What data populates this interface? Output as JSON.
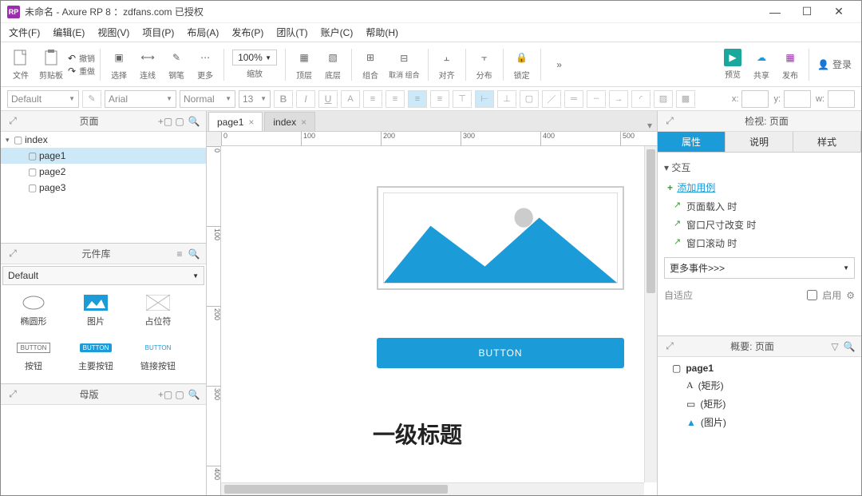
{
  "title": "未命名 - Axure RP 8 ：zdfans.com 已授权",
  "menus": [
    "文件(F)",
    "编辑(E)",
    "视图(V)",
    "项目(P)",
    "布局(A)",
    "发布(P)",
    "团队(T)",
    "账户(C)",
    "帮助(H)"
  ],
  "toolbar": {
    "file": "文件",
    "clipboard": "剪贴板",
    "undo": "撤销",
    "redo": "重做",
    "select": "选择",
    "connect": "连线",
    "pen": "钢笔",
    "more": "更多",
    "zoom": "100%",
    "zoom_lbl": "缩放",
    "front": "顶层",
    "back": "底层",
    "group": "组合",
    "ungroup": "取消 组合",
    "align": "对齐",
    "dist": "分布",
    "lockaxis": "锁定",
    "preview": "预览",
    "share": "共享",
    "publish": "发布",
    "login": "登录"
  },
  "fmt": {
    "style": "Default",
    "font": "Arial",
    "weight": "Normal",
    "size": "13",
    "x": "x:",
    "y": "y:",
    "w": "w:"
  },
  "panels": {
    "pages": "页面",
    "lib": "元件库",
    "masters": "母版",
    "inspect": "检视: 页面",
    "outline": "概要: 页面"
  },
  "pages": {
    "root": "index",
    "items": [
      "page1",
      "page2",
      "page3"
    ],
    "selected": "page1"
  },
  "lib_sel": "Default",
  "lib_items": [
    {
      "k": "ellipse",
      "l": "椭圆形"
    },
    {
      "k": "image",
      "l": "图片"
    },
    {
      "k": "placeholder",
      "l": "占位符"
    },
    {
      "k": "btn",
      "l": "按钮"
    },
    {
      "k": "pbtn",
      "l": "主要按钮"
    },
    {
      "k": "lbtn",
      "l": "链接按钮"
    }
  ],
  "tabs": [
    {
      "l": "page1",
      "active": true
    },
    {
      "l": "index",
      "active": false
    }
  ],
  "ruler_h": [
    "0",
    "100",
    "200",
    "300",
    "400",
    "500"
  ],
  "ruler_v": [
    "0",
    "100",
    "200",
    "300",
    "400"
  ],
  "canvas": {
    "button": "BUTTON",
    "h1": "一级标题"
  },
  "rtabs": [
    "属性",
    "说明",
    "样式"
  ],
  "interact": {
    "title": "交互",
    "add": "添加用例",
    "events": [
      "页面载入 时",
      "窗口尺寸改变 时",
      "窗口滚动 时"
    ],
    "more": "更多事件>>>",
    "adaptive": "自适应",
    "enable": "启用"
  },
  "outline": {
    "root": "page1",
    "items": [
      {
        "t": "A",
        "l": "(矩形)"
      },
      {
        "t": "rect",
        "l": "(矩形)"
      },
      {
        "t": "img",
        "l": "(图片)"
      }
    ]
  }
}
